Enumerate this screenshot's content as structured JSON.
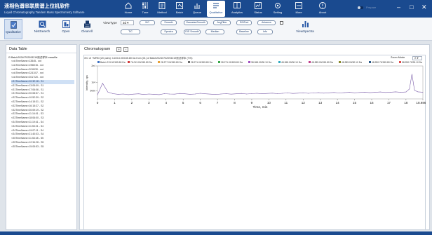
{
  "app": {
    "title": "液相色谱串联质谱上位机软件",
    "subtitle": "Liquid Chromatography Tandem Mass Spectrometry Software"
  },
  "nav": [
    {
      "label": "Home",
      "icon": "home-icon"
    },
    {
      "label": "Tune",
      "icon": "tune-icon"
    },
    {
      "label": "Method",
      "icon": "method-icon"
    },
    {
      "label": "Batch",
      "icon": "batch-icon"
    },
    {
      "label": "Queue",
      "icon": "queue-icon"
    },
    {
      "label": "Qualitative",
      "icon": "qualitative-icon",
      "active": true
    },
    {
      "label": "Analytics",
      "icon": "analytics-icon"
    },
    {
      "label": "Status",
      "icon": "status-icon"
    },
    {
      "label": "Setting",
      "icon": "setting-icon"
    },
    {
      "label": "More",
      "icon": "more-icon"
    },
    {
      "label": "About",
      "icon": "about-icon"
    }
  ],
  "window_controls": {
    "toggle_label": "Prepare",
    "minimize": "–",
    "maximize": "□",
    "close": "✕"
  },
  "toolbar": {
    "tools": [
      {
        "label": "Qualitative",
        "icon": "qualitative-doc-icon",
        "active": true
      },
      {
        "label": "NistSearch",
        "icon": "nist-search-icon"
      },
      {
        "label": "Open",
        "icon": "open-icon"
      },
      {
        "label": "ClearAll",
        "icon": "clear-all-icon"
      }
    ],
    "viewtype_label": "ViewType",
    "viewtype_value": "3d",
    "row1_buttons": [
      "XIC",
      "Smooth",
      "GaussianSmooth",
      "AvgFilter",
      "S/NTool",
      "Advance"
    ],
    "row2_buttons": [
      "TIC",
      "Spectra",
      "EIS Smooth",
      "Median",
      "Baseline",
      "Info"
    ],
    "view_spectra": "ViewSpectra"
  },
  "data_table": {
    "title": "Data Table",
    "root": "Batch20240702093219测试样本.massfile",
    "selected_index": 5,
    "items": [
      "<xicTimeName>13545 - snt",
      "<xicTimeName>1958/15 - snt",
      "<xicTimeName>2018/30 - snt",
      "<xicTimeName>2241/07 - snt",
      "<xicTimeName>2017/20 - snt",
      "<S1TimeName>10:32:18 - S1",
      "<S1TimeName>13:05:09 - S1",
      "<S1TimeName>17:06:06 - S1",
      "<S1TimeName>20:08:57 - S1",
      "<S2TimeName>10:52:39 - S2",
      "<S2TimeName>14:15:31 - S2",
      "<S2TimeName>16:15:27 - S2",
      "<S2TimeName>20:09:19 - S2",
      "<S3TimeName>11:16:01 - S3",
      "<S3TimeName>18:06:00 - S3",
      "<S4TimeName>11:19:41 - S4",
      "<S4TimeName>11:53:21 - S4",
      "<S4TimeName>19:07:11 - S4",
      "<S4TimeName>21:40:03 - S4",
      "<S5TimeName>11:53:45 - S5",
      "<S5TimeName>12:34:28 - S5",
      "<S5TimeName>15:05:53 - S5"
    ]
  },
  "chromatogram": {
    "title": "Chromatogram",
    "plus": "+",
    "minus": "-",
    "header": "XIC of +MRM (20 pairs): 14/213.00/155.80 Da from (01) of Batch20240702093219测试样本 (TIS)",
    "zoom_mode_label": "Zoom Mode",
    "zoom_mode_value": "X"
  },
  "chart_data": {
    "type": "line",
    "title": "XIC of +MRM (20 pairs): 14/213.00/155.80 Da from (01) of Batch20240702093219测试样本 (TIS)",
    "xlabel": "Time, min",
    "ylabel": "Intensity, cps",
    "xlim": [
      0,
      18.98666
    ],
    "ylim": [
      0,
      20000
    ],
    "x_ticks": [
      "0",
      "1",
      "2",
      "3",
      "4",
      "5",
      "6",
      "7",
      "8",
      "9",
      "10",
      "11",
      "12",
      "13",
      "14",
      "15",
      "16",
      "17",
      "18",
      "18.98666"
    ],
    "y_ticks": [
      "5000",
      "1e4",
      "2e4"
    ],
    "legend": [
      {
        "name": "Batch 213.00/155.80 Da",
        "color": "#3b6fc2"
      },
      {
        "name": "76.013.00/155.80 Da",
        "color": "#d23b3b"
      },
      {
        "name": "28.277.00/155.80 Da",
        "color": "#e8a23a"
      },
      {
        "name": "28.271.00/155.80 Da",
        "color": "#6e6e6e"
      },
      {
        "name": "28.271.00/155.80 Da",
        "color": "#3aa84a"
      },
      {
        "name": "38.268.00/90.10 Da",
        "color": "#a24fc2"
      },
      {
        "name": "48.268.00/90.10 Da",
        "color": "#2fa9c0"
      },
      {
        "name": "48.285.00/155.80 Da",
        "color": "#c23b8a"
      },
      {
        "name": "48.285.00/90.10 Da",
        "color": "#8a8a2a"
      },
      {
        "name": "48.250.70/155.80 Da",
        "color": "#2a5a8a"
      },
      {
        "name": "58.250.70/90.10 Da",
        "color": "#e04a4a"
      }
    ],
    "series": [
      {
        "name": "XIC 213.00/155.80 Da",
        "color": "#7a5ca8",
        "x": [
          0,
          0.3,
          0.6,
          0.9,
          1.2,
          1.5,
          1.8,
          2.1,
          2.4,
          2.7,
          3.0,
          3.3,
          3.6,
          3.9,
          4.2,
          4.5,
          4.8,
          5.1,
          5.4,
          5.7,
          6.0,
          6.3,
          6.6,
          6.9,
          7.2,
          7.5,
          7.8,
          8.1,
          8.4,
          8.7,
          9.0,
          9.3,
          9.6,
          9.9,
          10.2,
          10.5,
          10.8,
          11.1,
          11.4,
          11.7,
          12.0,
          12.3,
          12.6,
          12.9,
          13.2,
          13.5,
          13.8,
          14.1,
          14.4,
          14.7,
          15.0,
          15.3,
          15.6,
          15.9,
          16.2,
          16.5,
          16.8,
          17.1,
          17.4,
          17.7,
          18.0,
          18.2,
          18.35,
          18.5,
          18.7,
          18.98666
        ],
        "y": [
          2500,
          9500,
          4200,
          3200,
          2800,
          3000,
          2600,
          2900,
          3100,
          2700,
          3000,
          2800,
          2600,
          3200,
          3000,
          2900,
          3300,
          3100,
          2800,
          3000,
          3400,
          3100,
          2900,
          2700,
          3000,
          3200,
          2900,
          3100,
          3300,
          3000,
          3200,
          3400,
          3100,
          3300,
          3500,
          3200,
          3400,
          3600,
          3300,
          3500,
          3700,
          3400,
          3600,
          3800,
          3500,
          3700,
          3900,
          3600,
          3800,
          4000,
          3700,
          3900,
          4100,
          3800,
          4000,
          4200,
          3900,
          4100,
          4300,
          4000,
          4200,
          6000,
          15000,
          5200,
          4300,
          4100
        ]
      }
    ]
  }
}
